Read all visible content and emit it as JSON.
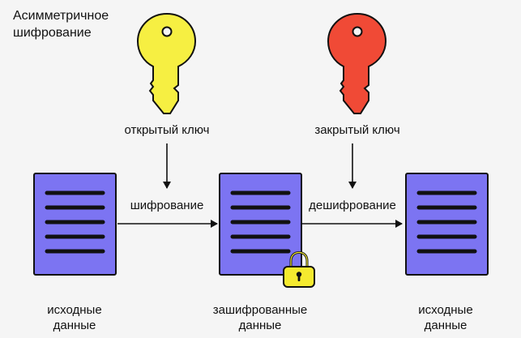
{
  "title": {
    "line1": "Асимметричное",
    "line2": "шифрование"
  },
  "keys": {
    "public_label": "открытый ключ",
    "private_label": "закрытый ключ",
    "public_color": "#f6ef42",
    "private_color": "#f04a36"
  },
  "process": {
    "encrypt_label": "шифрование",
    "decrypt_label": "дешифрование"
  },
  "documents": {
    "source_line1": "исходные",
    "source_line2": "данные",
    "encrypted_line1": "зашифрованные",
    "encrypted_line2": "данные",
    "result_line1": "исходные",
    "result_line2": "данные",
    "doc_color": "#7c74f2",
    "lock_color": "#f5ea2f"
  }
}
